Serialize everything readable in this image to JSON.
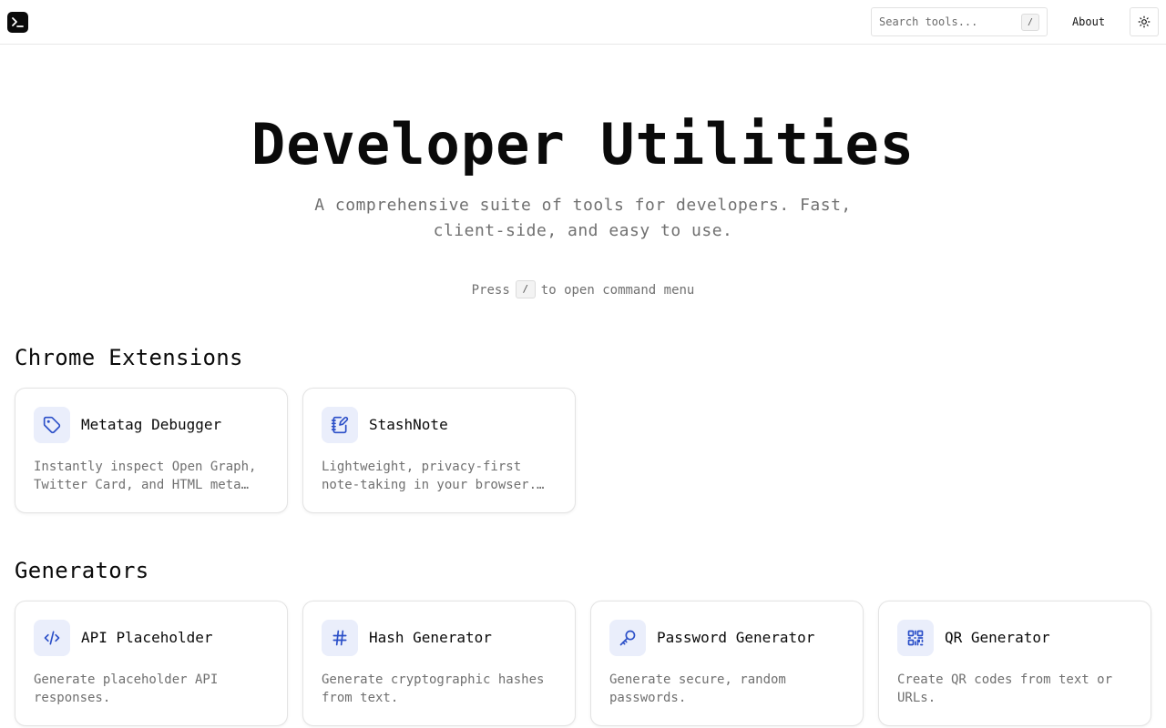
{
  "header": {
    "search_placeholder": "Search tools...",
    "search_shortcut": "/",
    "about_label": "About"
  },
  "hero": {
    "title": "Developer Utilities",
    "subtitle": "A comprehensive suite of tools for developers. Fast, client-side, and easy to use.",
    "press_before": "Press",
    "press_key": "/",
    "press_after": "to open command menu"
  },
  "sections": [
    {
      "title": "Chrome Extensions",
      "cards": [
        {
          "title": "Metatag Debugger",
          "description": "Instantly inspect Open Graph, Twitter Card, and HTML meta…",
          "icon": "tag-icon"
        },
        {
          "title": "StashNote",
          "description": "Lightweight, privacy-first note-taking in your browser.…",
          "icon": "notebook-pen-icon"
        }
      ]
    },
    {
      "title": "Generators",
      "cards": [
        {
          "title": "API Placeholder",
          "description": "Generate placeholder API responses.",
          "icon": "code-icon"
        },
        {
          "title": "Hash Generator",
          "description": "Generate cryptographic hashes from text.",
          "icon": "hash-icon"
        },
        {
          "title": "Password Generator",
          "description": "Generate secure, random passwords.",
          "icon": "key-icon"
        },
        {
          "title": "QR Generator",
          "description": "Create QR codes from text or URLs.",
          "icon": "qr-code-icon"
        }
      ]
    }
  ],
  "colors": {
    "accent_icon": "#2b4fc8",
    "icon_bg": "#eaeefb",
    "muted_text": "#707070"
  }
}
